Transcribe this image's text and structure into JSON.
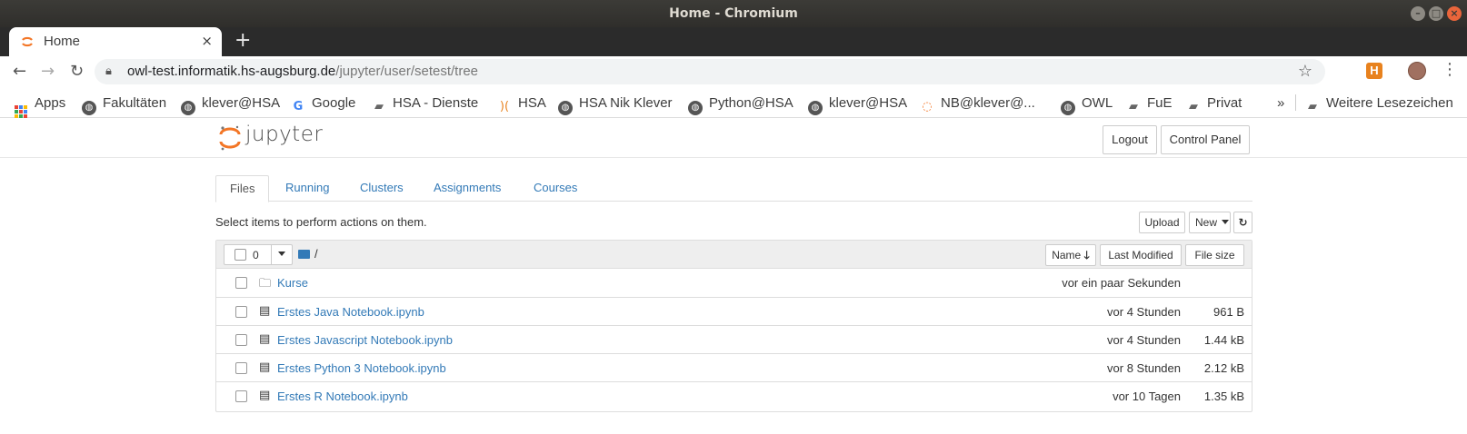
{
  "window": {
    "title": "Home - Chromium",
    "controls": {
      "minimize": "–",
      "maximize": "□",
      "close": "×"
    }
  },
  "browser": {
    "tab": {
      "title": "Home",
      "close": "×"
    },
    "new_tab": "+",
    "nav": {
      "back": "←",
      "forward": "→",
      "reload": "↻"
    },
    "url_host": "owl-test.informatik.hs-augsburg.de",
    "url_path": "/jupyter/user/setest/tree",
    "star": "☆",
    "ext_label": "H",
    "menu": "⋮"
  },
  "bookmarks": {
    "items": [
      {
        "label": "Apps",
        "icon": "apps-grid-icon"
      },
      {
        "label": "Fakultäten",
        "icon": "globe-icon"
      },
      {
        "label": "klever@HSA",
        "icon": "globe-icon"
      },
      {
        "label": "Google",
        "icon": "google-icon"
      },
      {
        "label": "HSA - Dienste",
        "icon": "folder-icon"
      },
      {
        "label": "HSA",
        "icon": "hsa-icon"
      },
      {
        "label": "HSA Nik Klever",
        "icon": "globe-icon"
      },
      {
        "label": "Python@HSA",
        "icon": "globe-icon"
      },
      {
        "label": "klever@HSA",
        "icon": "globe-icon"
      },
      {
        "label": "NB@klever@...",
        "icon": "jupyter-icon"
      },
      {
        "label": "OWL",
        "icon": "globe-icon"
      },
      {
        "label": "FuE",
        "icon": "folder-icon"
      },
      {
        "label": "Privat",
        "icon": "folder-icon"
      }
    ],
    "overflow": "»",
    "other": "Weitere Lesezeichen"
  },
  "jupyter": {
    "logo_text": "jupyter",
    "logout": "Logout",
    "control_panel": "Control Panel",
    "tabs": [
      "Files",
      "Running",
      "Clusters",
      "Assignments",
      "Courses"
    ],
    "active_tab": "Files",
    "hint": "Select items to perform actions on them.",
    "upload": "Upload",
    "new": "New",
    "refresh_icon": "refresh-icon",
    "selected_count": "0",
    "breadcrumb": "/",
    "sort": {
      "name": "Name",
      "last_modified": "Last Modified",
      "file_size": "File size"
    },
    "files": [
      {
        "name": "Kurse",
        "type": "folder",
        "modified": "vor ein paar Sekunden",
        "size": ""
      },
      {
        "name": "Erstes Java Notebook.ipynb",
        "type": "notebook",
        "modified": "vor 4 Stunden",
        "size": "961 B"
      },
      {
        "name": "Erstes Javascript Notebook.ipynb",
        "type": "notebook",
        "modified": "vor 4 Stunden",
        "size": "1.44 kB"
      },
      {
        "name": "Erstes Python 3 Notebook.ipynb",
        "type": "notebook",
        "modified": "vor 8 Stunden",
        "size": "2.12 kB"
      },
      {
        "name": "Erstes R Notebook.ipynb",
        "type": "notebook",
        "modified": "vor 10 Tagen",
        "size": "1.35 kB"
      }
    ]
  },
  "colors": {
    "link": "#337ab7",
    "jupyter_orange": "#f37626",
    "titlebar": "#3c3b37"
  }
}
